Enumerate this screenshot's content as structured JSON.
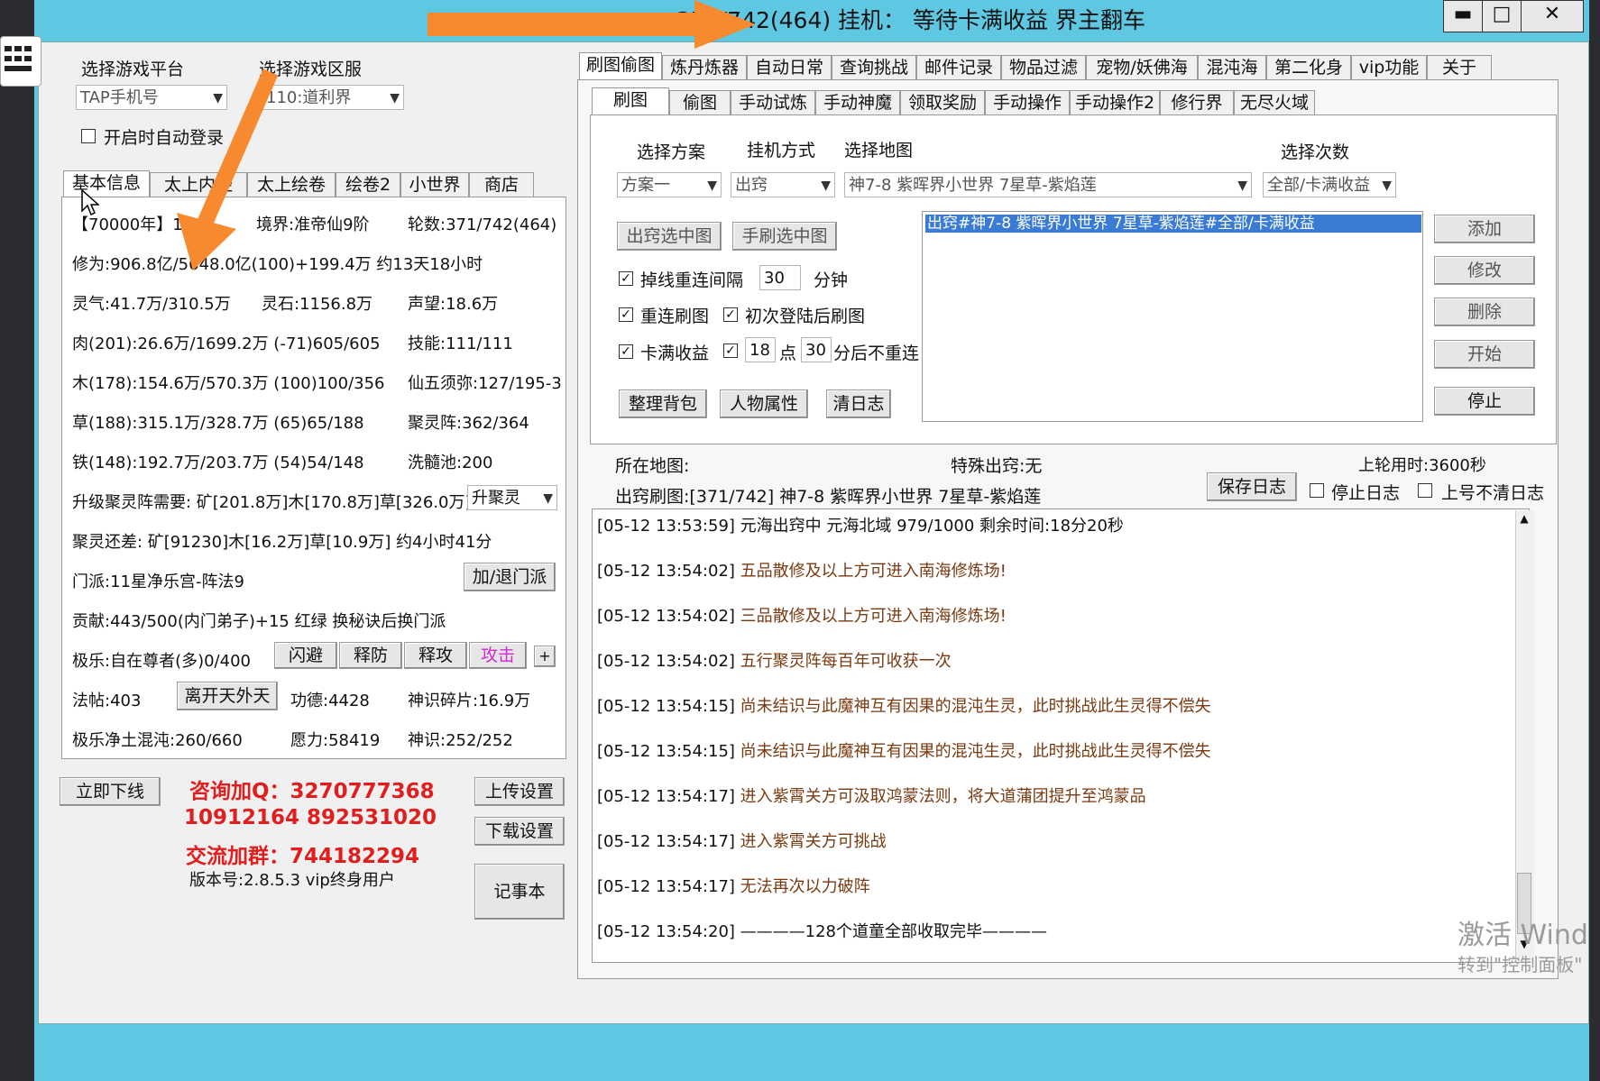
{
  "title": "371/742(464) 挂机： 等待卡满收益 界主翻车",
  "window_buttons": {
    "minimize": "▬",
    "maximize": "□",
    "close": "✕"
  },
  "left": {
    "platform_label": "选择游戏平台",
    "server_label": "选择游戏区服",
    "platform_value": "TAP手机号",
    "server_value": "110:道利界",
    "auto_login_label": "开启时自动登录",
    "tabs": [
      "基本信息",
      "太上内经",
      "太上绘卷",
      "绘卷2",
      "小世界",
      "商店"
    ],
    "info": {
      "rank": "【70000年】1",
      "realm": "境界:准帝仙9阶",
      "rounds": "轮数:371/742(464)",
      "cultivation": "修为:906.8亿/5648.0亿(100)+199.4万 约13天18小时",
      "lingqi": "灵气:41.7万/310.5万",
      "lingshi": "灵石:1156.8万",
      "fame": "声望:18.6万",
      "meat": "肉(201):26.6万/1699.2万 (-71)605/605",
      "skill": "技能:111/111",
      "wood": "木(178):154.6万/570.3万 (100)100/356",
      "xianwu": "仙五须弥:127/195-3",
      "grass": "草(188):315.1万/328.7万 (65)65/188",
      "julingzhen": "聚灵阵:362/364",
      "iron": "铁(148):192.7万/203.7万 (54)54/148",
      "xisuichi": "洗髓池:200",
      "upgrade_need": "升级聚灵阵需要: 矿[201.8万]木[170.8万]草[326.0万]",
      "upgrade_select": "升聚灵",
      "still_need": "聚灵还差: 矿[91230]木[16.2万]草[10.9万] 约4小时41分",
      "sect": "门派:11星净乐宫-阵法9",
      "sect_button": "加/退门派",
      "contribution": "贡献:443/500(内门弟子)+15 红绿 换秘诀后换门派",
      "jile": "极乐:自在尊者(多)0/400",
      "skill_buttons": [
        "闪避",
        "释防",
        "释攻",
        "攻击"
      ],
      "plus_button": "+",
      "fatie": "法帖:403",
      "leave_button": "离开天外天",
      "merit": "功德:4428",
      "shenshi_frag": "神识碎片:16.9万",
      "jile_hundun": "极乐净土混沌:260/660",
      "yuanli": "愿力:58419",
      "shenshi": "神识:252/252"
    },
    "offline_button": "立即下线",
    "contact": {
      "qq_line": "咨询加Q：3270777368",
      "qq_line2": "10912164  892531020",
      "group_line": "交流加群：744182294"
    },
    "version": "版本号:2.8.5.3 vip终身用户",
    "upload_button": "上传设置",
    "download_button": "下载设置",
    "notebook_button": "记事本"
  },
  "right": {
    "top_tabs": [
      "刷图偷图",
      "炼丹炼器",
      "自动日常",
      "查询挑战",
      "邮件记录",
      "物品过滤",
      "宠物/妖佛海",
      "混沌海",
      "第二化身",
      "vip功能",
      "关于"
    ],
    "sub_tabs": [
      "刷图",
      "偷图",
      "手动试炼",
      "手动神魔",
      "领取奖励",
      "手动操作",
      "手动操作2",
      "修行界",
      "无尽火域"
    ],
    "plan_label": "选择方案",
    "mode_label": "挂机方式",
    "map_label": "选择地图",
    "count_label": "选择次数",
    "plan_value": "方案一",
    "mode_value": "出窍",
    "map_value": "神7-8  紫晖界小世界  7星草-紫焰莲",
    "count_value": "全部/卡满收益",
    "btn_go_selected": "出窍选中图",
    "btn_manual_selected": "手刷选中图",
    "reconnect_label": "掉线重连间隔",
    "reconnect_value": "30",
    "minutes_label": "分钟",
    "reconnect_refresh": "重连刷图",
    "first_login_refresh": "初次登陆后刷图",
    "card_full": "卡满收益",
    "hour_value": "18",
    "hour_label": "点",
    "minute_value": "30",
    "no_reconnect_label": "分后不重连",
    "btn_sort_bag": "整理背包",
    "btn_char_attr": "人物属性",
    "btn_clear_log": "清日志",
    "list_item": "出窍#神7-8  紫晖界小世界  7星草-紫焰莲#全部/卡满收益",
    "btn_add": "添加",
    "btn_modify": "修改",
    "btn_delete": "删除",
    "btn_start": "开始",
    "btn_stop": "停止",
    "current_map_label": "所在地图:",
    "special_label": "特殊出窍:无",
    "last_round_label": "上轮用时:3600秒",
    "route_label": "出窍刷图:[371/742] 神7-8  紫晖界小世界  7星草-紫焰莲",
    "btn_save_log": "保存日志",
    "stop_log_label": "停止日志",
    "no_clear_label": "上号不清日志",
    "log": [
      {
        "ts": "[05-12 13:53:59]",
        "msg": "元海出窍中 元海北域 979/1000 剩余时间:18分20秒",
        "plain": true
      },
      {
        "ts": "[05-12 13:54:02]",
        "msg": "五品散修及以上方可进入南海修炼场!",
        "plain": false
      },
      {
        "ts": "[05-12 13:54:02]",
        "msg": "三品散修及以上方可进入南海修炼场!",
        "plain": false
      },
      {
        "ts": "[05-12 13:54:02]",
        "msg": "五行聚灵阵每百年可收获一次",
        "plain": false
      },
      {
        "ts": "[05-12 13:54:15]",
        "msg": "尚未结识与此魔神互有因果的混沌生灵，此时挑战此生灵得不偿失",
        "plain": false
      },
      {
        "ts": "[05-12 13:54:15]",
        "msg": "尚未结识与此魔神互有因果的混沌生灵，此时挑战此生灵得不偿失",
        "plain": false
      },
      {
        "ts": "[05-12 13:54:17]",
        "msg": "进入紫霄关方可汲取鸿蒙法则，将大道蒲团提升至鸿蒙品",
        "plain": false
      },
      {
        "ts": "[05-12 13:54:17]",
        "msg": "进入紫霄关方可挑战",
        "plain": false
      },
      {
        "ts": "[05-12 13:54:17]",
        "msg": "无法再次以力破阵",
        "plain": false
      },
      {
        "ts": "[05-12 13:54:20]",
        "msg": "————128个道童全部收取完毕————",
        "plain": true
      }
    ]
  },
  "watermark": {
    "line1": "激活 Wind",
    "line2": "转到\"控制面板\""
  },
  "colors": {
    "background": "#5ec8e3",
    "client": "#f0f0f0",
    "accent_orange": "#f78a2e",
    "contact_red": "#e01e1e",
    "log_brown": "#7a3a10",
    "selection_blue": "#3a7bd5"
  }
}
